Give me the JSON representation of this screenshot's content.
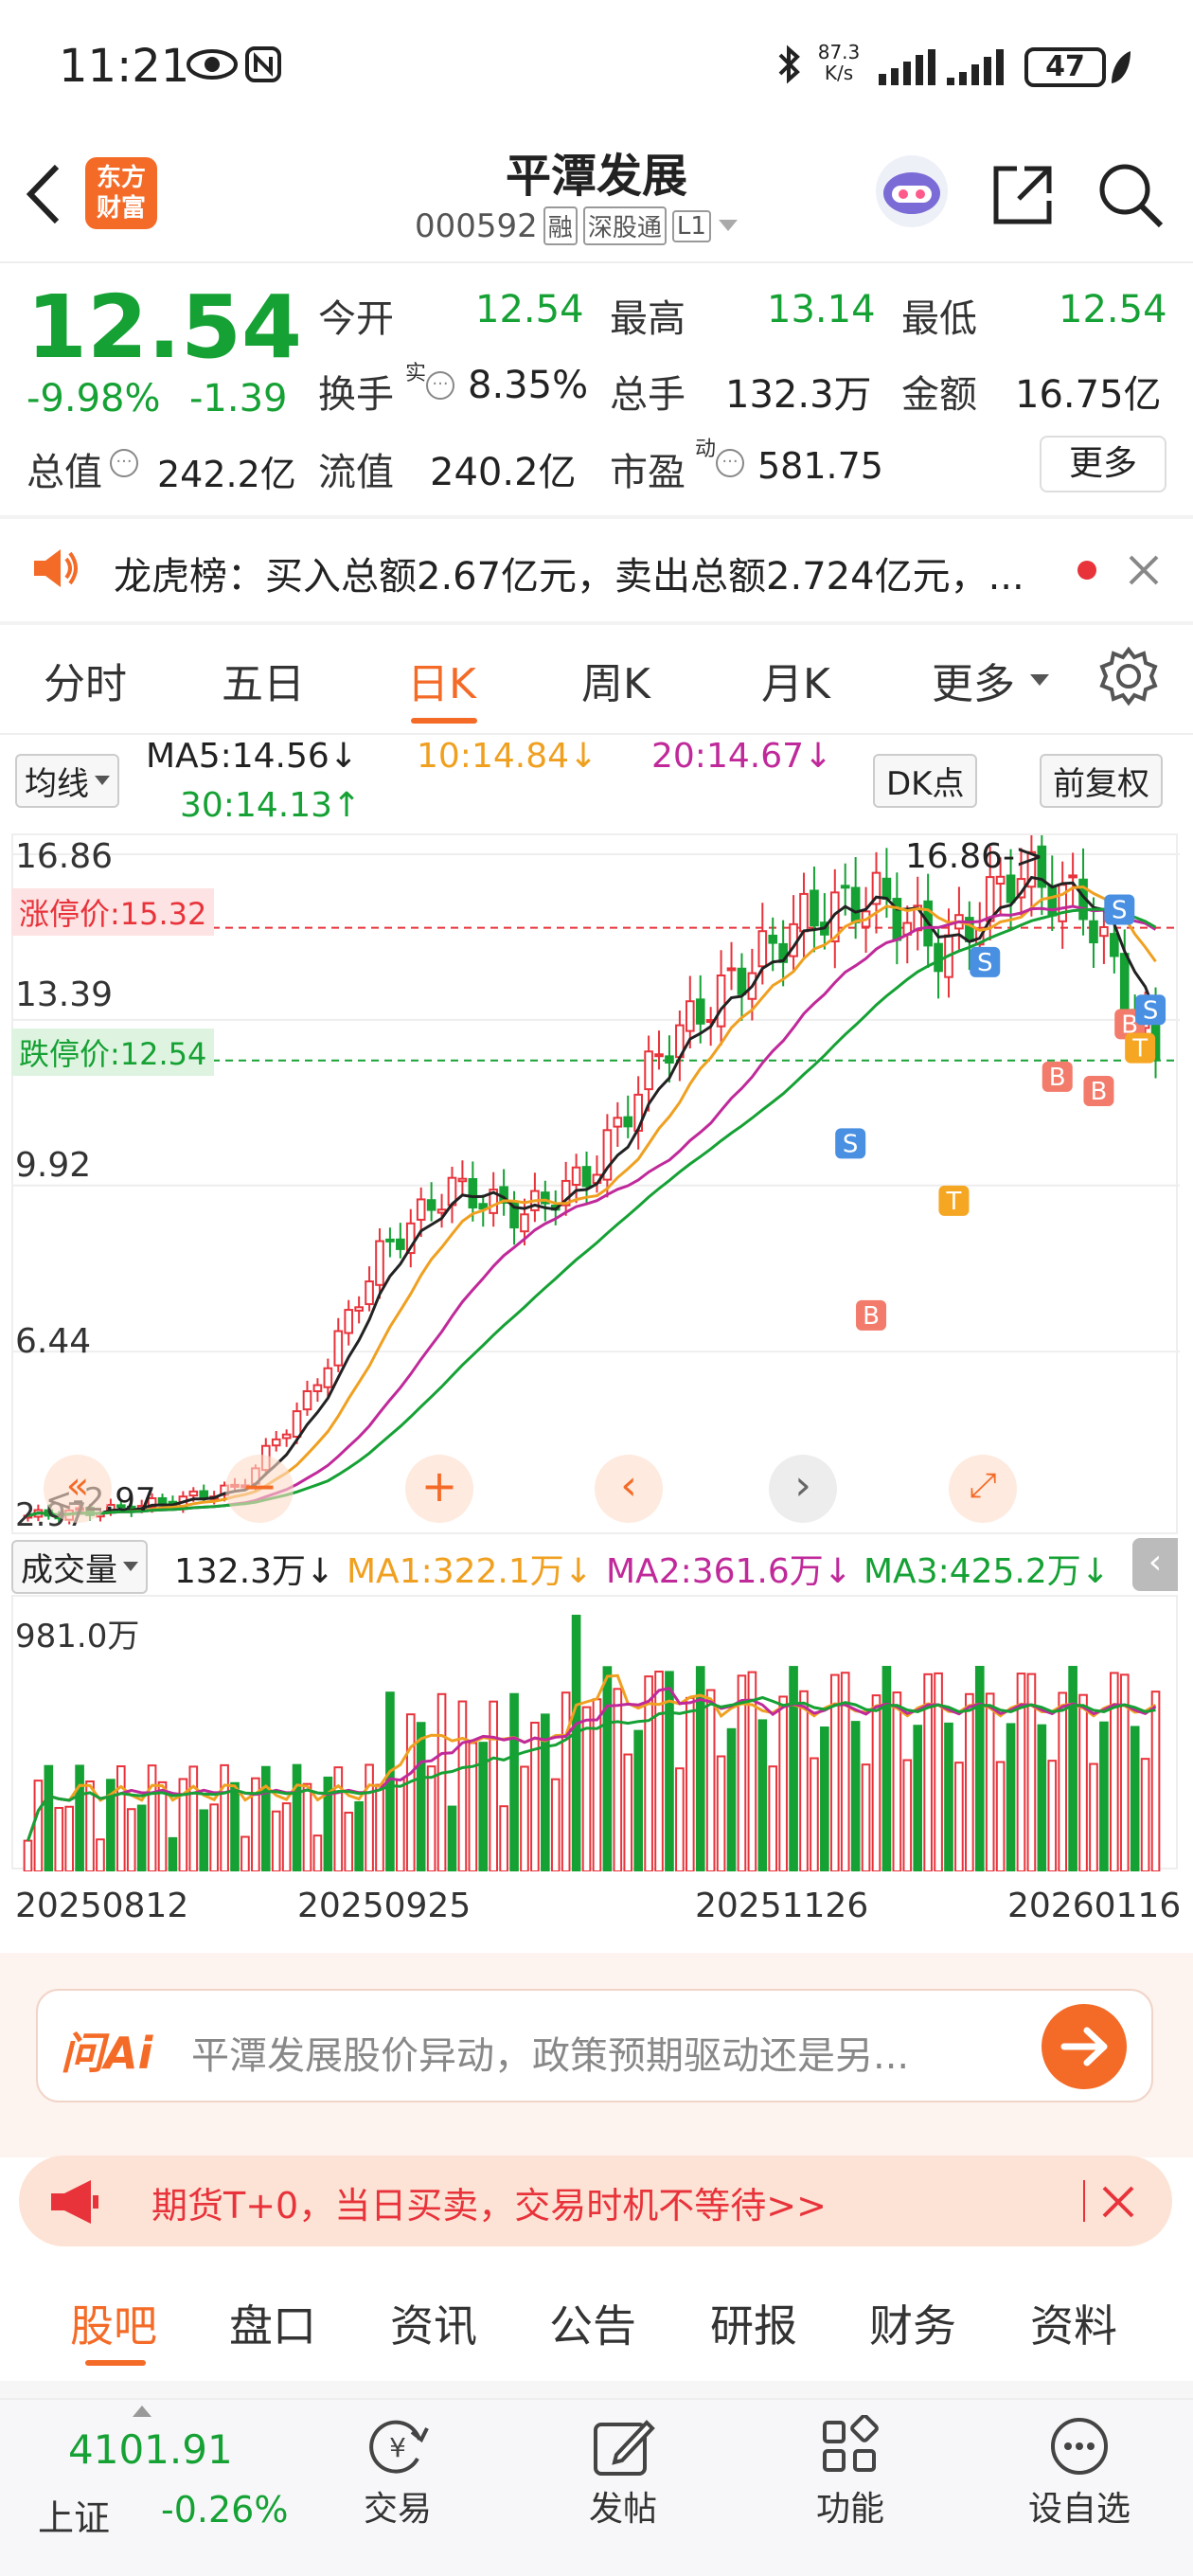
{
  "status_bar": {
    "time": "11:21",
    "net_speed_top": "87.3",
    "net_speed_bottom": "K/s",
    "battery": "47"
  },
  "header": {
    "stock_name": "平潭发展",
    "stock_code": "000592",
    "badges": [
      "融",
      "深股通",
      "L1"
    ],
    "logo_text_1": "东方",
    "logo_text_2": "财富"
  },
  "quote": {
    "price": "12.54",
    "change_pct": "-9.98%",
    "change_abs": "-1.39",
    "rows": [
      [
        {
          "label": "今开",
          "value": "12.54",
          "color": "green"
        },
        {
          "label": "最高",
          "value": "13.14",
          "color": "green"
        },
        {
          "label": "最低",
          "value": "12.54",
          "color": "green"
        }
      ],
      [
        {
          "label": "换手",
          "sup": "实",
          "value": "8.35%",
          "color": "dark"
        },
        {
          "label": "总手",
          "value": "132.3万",
          "color": "dark"
        },
        {
          "label": "金额",
          "value": "16.75亿",
          "color": "dark"
        }
      ],
      [
        {
          "label": "总值",
          "value": "242.2亿",
          "color": "dark"
        },
        {
          "label": "流值",
          "value": "240.2亿",
          "color": "dark"
        },
        {
          "label": "市盈",
          "sup": "动",
          "value": "581.75",
          "color": "dark"
        }
      ]
    ],
    "more_button": "更多"
  },
  "notice": {
    "text": "龙虎榜：买入总额2.67亿元，卖出总额2.724亿元，..."
  },
  "chart_tabs": [
    "分时",
    "五日",
    "日K",
    "周K",
    "月K",
    "更多"
  ],
  "active_tab": "日K",
  "ma_bar": {
    "selector": "均线",
    "ma5": "MA5:14.56↓",
    "ma10": "10:14.84↓",
    "ma20": "20:14.67↓",
    "ma30": "30:14.13↑",
    "dk_button": "DK点",
    "fq_button": "前复权"
  },
  "price_chart": {
    "y_labels": [
      "16.86",
      "13.39",
      "9.92",
      "6.44",
      "2.97"
    ],
    "limit_up": "涨停价:15.32",
    "limit_down": "跌停价:12.54",
    "high_marker": "16.86->",
    "low_marker": "<-2.97"
  },
  "volume_bar": {
    "selector": "成交量",
    "vol": "132.3万↓",
    "ma1": "MA1:322.1万↓",
    "ma2": "MA2:361.6万↓",
    "ma3": "MA3:425.2万↓",
    "max_label": "981.0万",
    "dates": [
      "20250812",
      "20250925",
      "20251126",
      "20260116"
    ]
  },
  "ai_bar": {
    "logo": "问Ai",
    "placeholder": "平潭发展股价异动，政策预期驱动还是另..."
  },
  "promo": {
    "text": "期货T+0，当日买卖，交易时机不等待>>"
  },
  "section_tabs": [
    "股吧",
    "盘口",
    "资讯",
    "公告",
    "研报",
    "财务",
    "资料"
  ],
  "bottom_nav": {
    "index_value": "4101.91",
    "index_name": "上证",
    "index_change": "-0.26%",
    "items": [
      "交易",
      "发帖",
      "功能",
      "设自选"
    ]
  },
  "colors": {
    "up_red": "#e8333b",
    "down_green": "#15a134",
    "accent_orange": "#f46b28",
    "ma10_orange": "#f0a020",
    "ma20_magenta": "#c0299a"
  },
  "chart_data": {
    "type": "candlestick",
    "x_range_labels": [
      "20250812",
      "20250925",
      "20251126",
      "20260116"
    ],
    "ylim": [
      2.97,
      16.86
    ],
    "close_approx": [
      3.0,
      3.1,
      3.3,
      3.6,
      5.5,
      8.5,
      9.9,
      9.3,
      10.2,
      12.8,
      14.2,
      15.5,
      16.0,
      14.8,
      16.5,
      15.8,
      12.54
    ]
  }
}
